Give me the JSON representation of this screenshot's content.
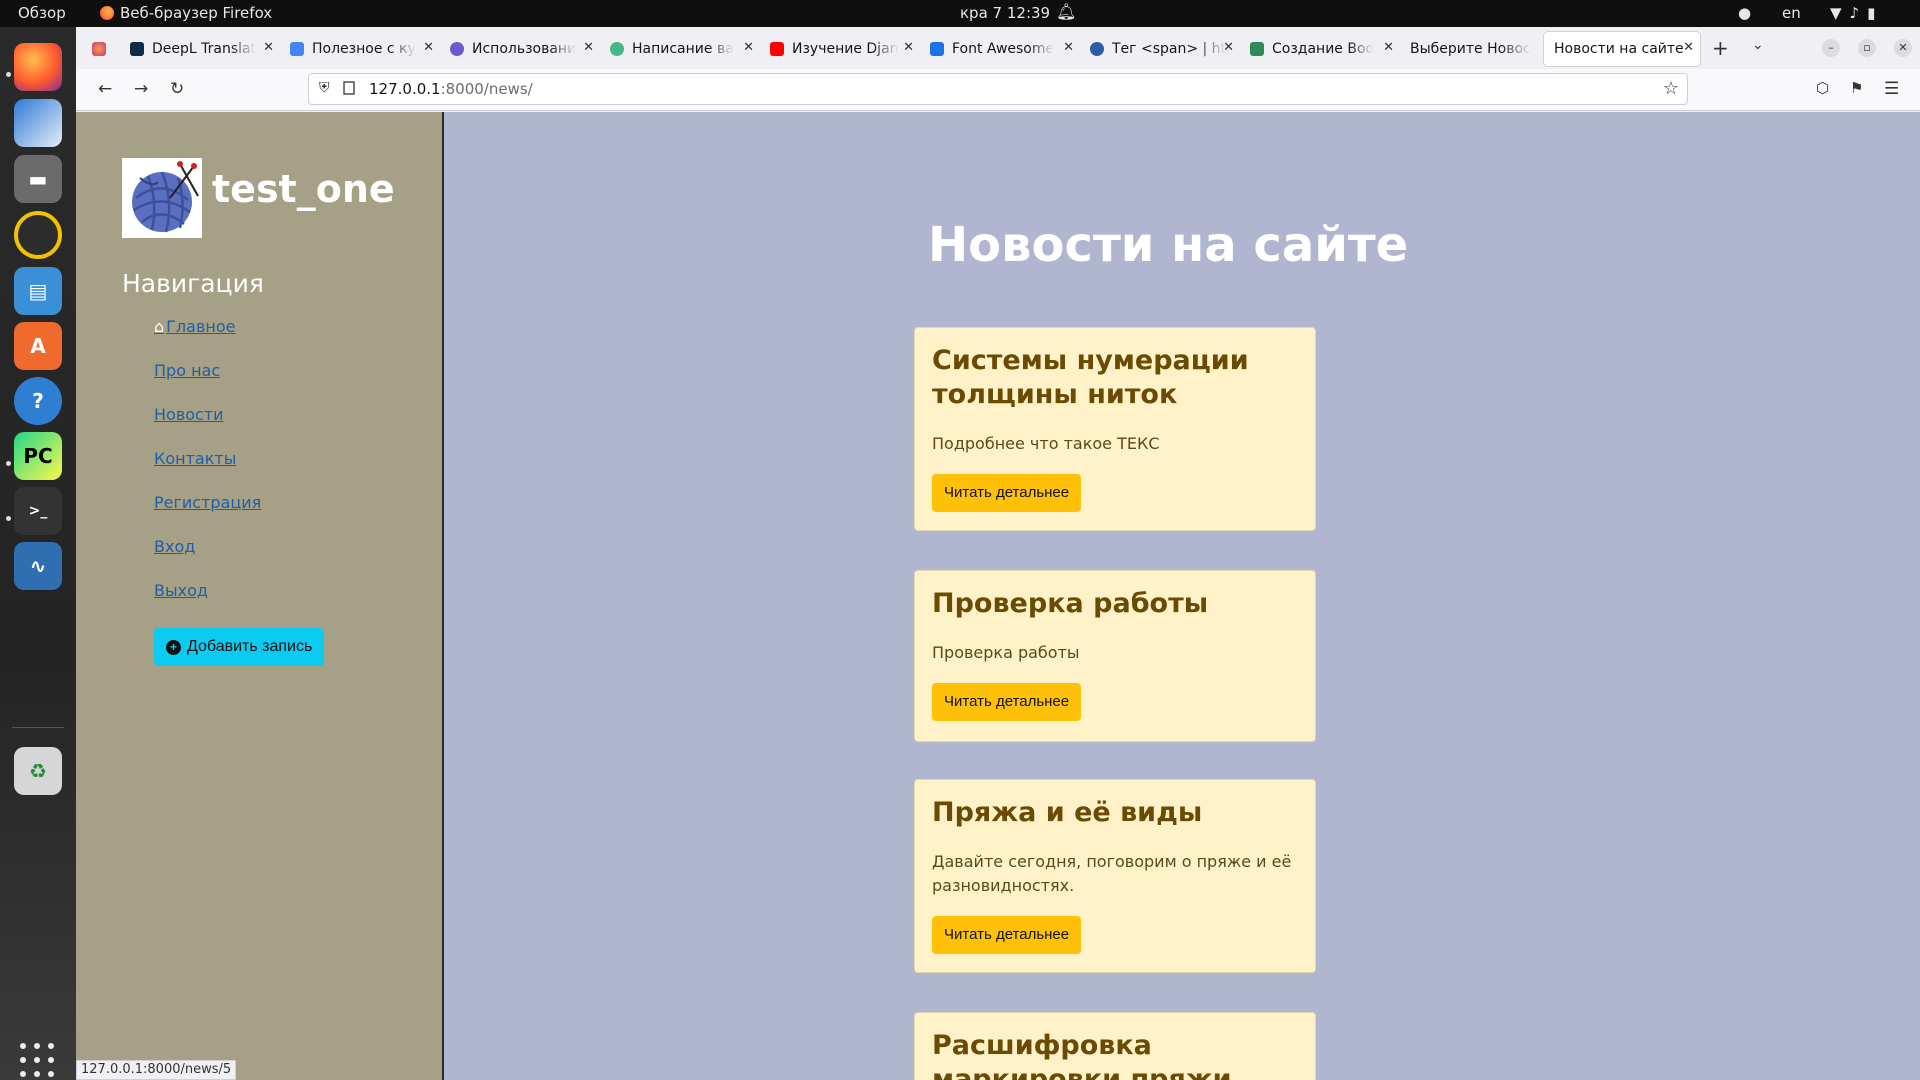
{
  "system": {
    "activities": "Обзор",
    "app_menu": "Веб-браузер Firefox",
    "clock": "кра 7  12:39",
    "keyboard_layout": "en",
    "icons": [
      "bell-icon",
      "wifi-icon",
      "volume-icon",
      "battery-icon"
    ]
  },
  "dock": {
    "apps": [
      "firefox",
      "thunderbird",
      "files",
      "rhythmbox",
      "writer",
      "app-center",
      "help",
      "pycharm",
      "terminal",
      "system-monitor",
      "trash",
      "show-apps"
    ]
  },
  "browser": {
    "tabs": [
      {
        "title": ""
      },
      {
        "title": "DeepL Translat"
      },
      {
        "title": "Полезное с ку"
      },
      {
        "title": "Использовани"
      },
      {
        "title": "Написание ва"
      },
      {
        "title": "Изучение Djan"
      },
      {
        "title": "Font Awesome"
      },
      {
        "title": "Тег <span> | ht"
      },
      {
        "title": "Создание Boo"
      },
      {
        "title": "Выберите Новос"
      },
      {
        "title": "Новости на сайте",
        "active": true
      }
    ],
    "url_host": "127.0.0.1",
    "url_path": ":8000/news/",
    "status_url": "127.0.0.1:8000/news/5"
  },
  "page": {
    "site_name": "test_one",
    "nav_heading": "Навигация",
    "nav_items": [
      "Главное",
      "Про нас",
      "Новости",
      "Контакты",
      "Регистрация",
      "Вход",
      "Выход"
    ],
    "add_button": "Добавить запись",
    "heading": "Новости на сайте",
    "read_more": "Читать детальнее",
    "news": [
      {
        "title": "Системы нумерации толщины ниток",
        "text": "Подробнее что такое ТЕКС"
      },
      {
        "title": "Проверка работы",
        "text": "Проверка работы"
      },
      {
        "title": "Пряжа и её виды",
        "text": "Давайте сегодня, поговорим о пряже и её разновидностях."
      },
      {
        "title": "Расшифровка маркировки пряжи",
        "text": ""
      }
    ],
    "colors": {
      "sidebar": "#a5a086",
      "background": "#b0b5d0",
      "card": "#fff2c8",
      "button": "#ffc107",
      "add_button": "#0dcaf0"
    }
  }
}
